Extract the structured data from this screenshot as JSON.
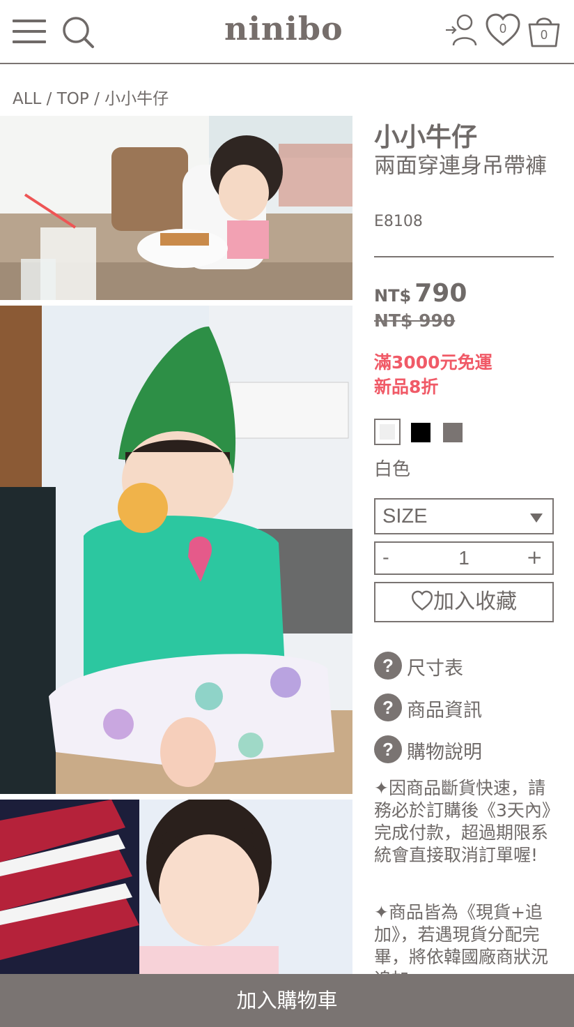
{
  "header": {
    "logo": "ninibo",
    "wishlist_count": "0",
    "cart_count": "0"
  },
  "breadcrumb": {
    "items": [
      "ALL",
      "TOP",
      "小小牛仔"
    ],
    "separator": " / "
  },
  "product": {
    "name": "小小牛仔",
    "subtitle": "兩面穿連身吊帶褲",
    "code": "E8108",
    "price_currency": "NT$",
    "price": "790",
    "original_price": "NT$ 990",
    "promos": [
      "滿3000元免運",
      "新品8折"
    ],
    "colors": [
      {
        "name": "white",
        "hex": "#efefef"
      },
      {
        "name": "black",
        "hex": "#000000"
      },
      {
        "name": "gray",
        "hex": "#7a7472"
      }
    ],
    "selected_color": "白色",
    "size_placeholder": "SIZE",
    "quantity": "1",
    "qty_minus": "-",
    "qty_plus": "+",
    "wishlist_label": "加入收藏"
  },
  "help_links": [
    {
      "icon": "?",
      "label": "尺寸表"
    },
    {
      "icon": "?",
      "label": "商品資訊"
    },
    {
      "icon": "?",
      "label": "購物說明"
    }
  ],
  "notices": [
    "✦因商品斷貨快速，請務必於訂購後《3天內》完成付款，超過期限系統會直接取消訂單喔!",
    "✦商品皆為《現貨+追加》，若遇現貨分配完畢，將依韓國廠商狀況追加"
  ],
  "add_to_cart_label": "加入購物車",
  "colors": {
    "text": "#6f6a68",
    "accent_bar": "#7a7472",
    "promo": "#f05a67"
  }
}
